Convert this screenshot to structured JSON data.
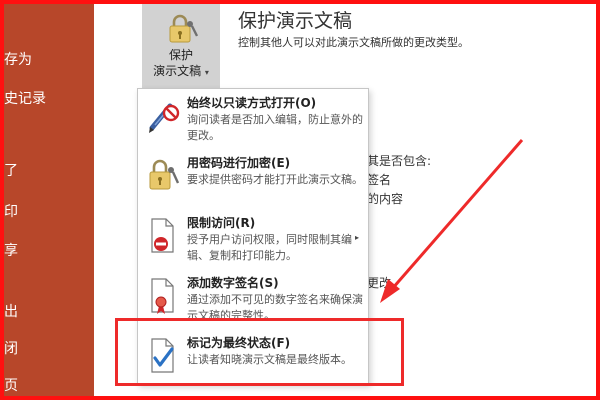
{
  "sidebar": {
    "items": [
      {
        "label": "存为"
      },
      {
        "label": "史记录"
      },
      {
        "label": "了"
      },
      {
        "label": "印"
      },
      {
        "label": "享"
      },
      {
        "label": "出"
      },
      {
        "label": "闭"
      },
      {
        "label": "页"
      }
    ]
  },
  "protect": {
    "button_line1": "保护",
    "button_line2": "演示文稿",
    "caret": "▾",
    "title": "保护演示文稿",
    "description": "控制其他人可以对此演示文稿所做的更改类型。"
  },
  "background_text": {
    "line1": "意其是否包含:",
    "line2": "签名",
    "line3": "的内容",
    "line4": "更改。"
  },
  "menu": {
    "items": [
      {
        "icon": "pencil-prohibited-icon",
        "title": "始终以只读方式打开(O)",
        "description": "询问读者是否加入编辑，防止意外的更改。"
      },
      {
        "icon": "lock-key-icon",
        "title": "用密码进行加密(E)",
        "description": "要求提供密码才能打开此演示文稿。"
      },
      {
        "icon": "restricted-document-icon",
        "title": "限制访问(R)",
        "description": "授予用户访问权限，同时限制其编辑、复制和打印能力。",
        "has_submenu": true,
        "arrow": "▸"
      },
      {
        "icon": "certificate-ribbon-icon",
        "title": "添加数字签名(S)",
        "description": "通过添加不可见的数字签名来确保演示文稿的完整性。"
      },
      {
        "icon": "document-check-icon",
        "title": "标记为最终状态(F)",
        "description": "让读者知晓演示文稿是最终版本。"
      }
    ]
  },
  "colors": {
    "sidebar": "#b7472a",
    "annotation": "#ee2a2a",
    "checkmark": "#2b72c4",
    "prohibit": "#d0262a"
  }
}
